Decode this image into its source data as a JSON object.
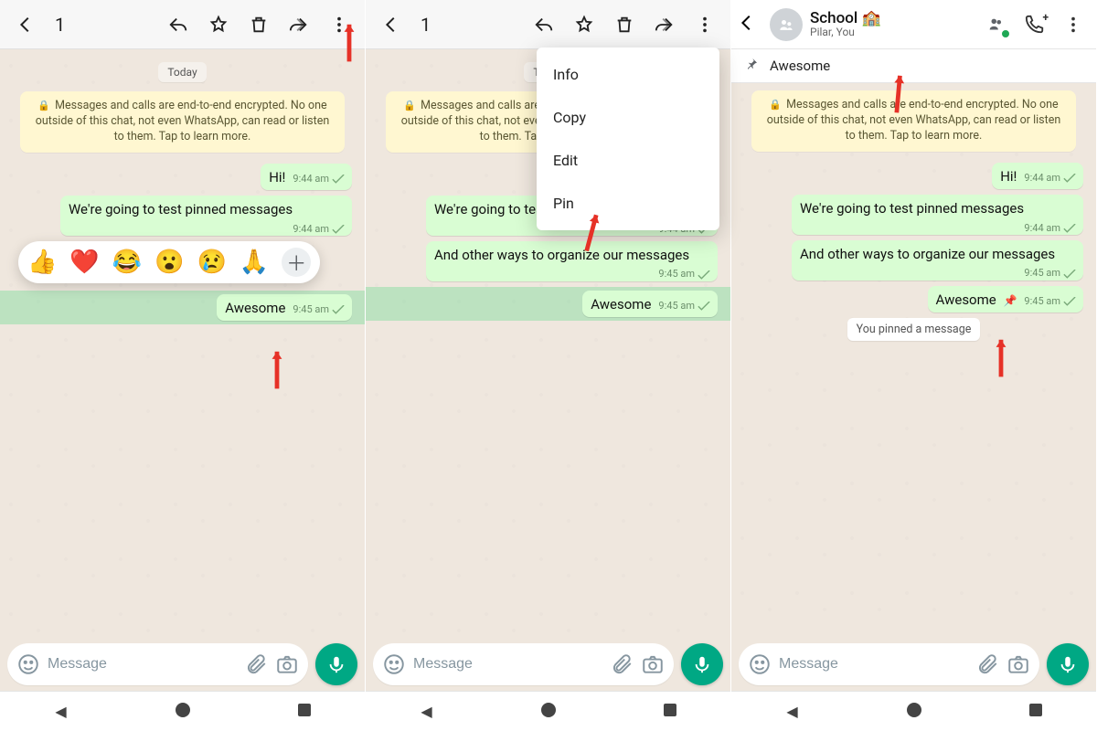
{
  "selectToolbar": {
    "count": "1"
  },
  "date_label": "Today",
  "e2e_text": "Messages and calls are end-to-end encrypted. No one outside of this chat, not even WhatsApp, can read or listen to them. Tap to learn more.",
  "messages": {
    "hi": {
      "text": "Hi!",
      "time": "9:44 am"
    },
    "test": {
      "text": "We're going to test pinned messages",
      "time": "9:44 am"
    },
    "other": {
      "text": "And other ways to organize our messages",
      "time": "9:45 am"
    },
    "awesome": {
      "text": "Awesome",
      "time": "9:45 am"
    }
  },
  "reactions": [
    "👍",
    "❤️",
    "😂",
    "😮",
    "😢",
    "🙏"
  ],
  "context_menu": {
    "info": "Info",
    "copy": "Copy",
    "edit": "Edit",
    "pin": "Pin"
  },
  "chat_header": {
    "name": "School 🏫",
    "subtitle": "Pilar, You"
  },
  "pinned_banner": {
    "text": "Awesome"
  },
  "system_chip": "You pinned a message",
  "input": {
    "placeholder": "Message"
  }
}
